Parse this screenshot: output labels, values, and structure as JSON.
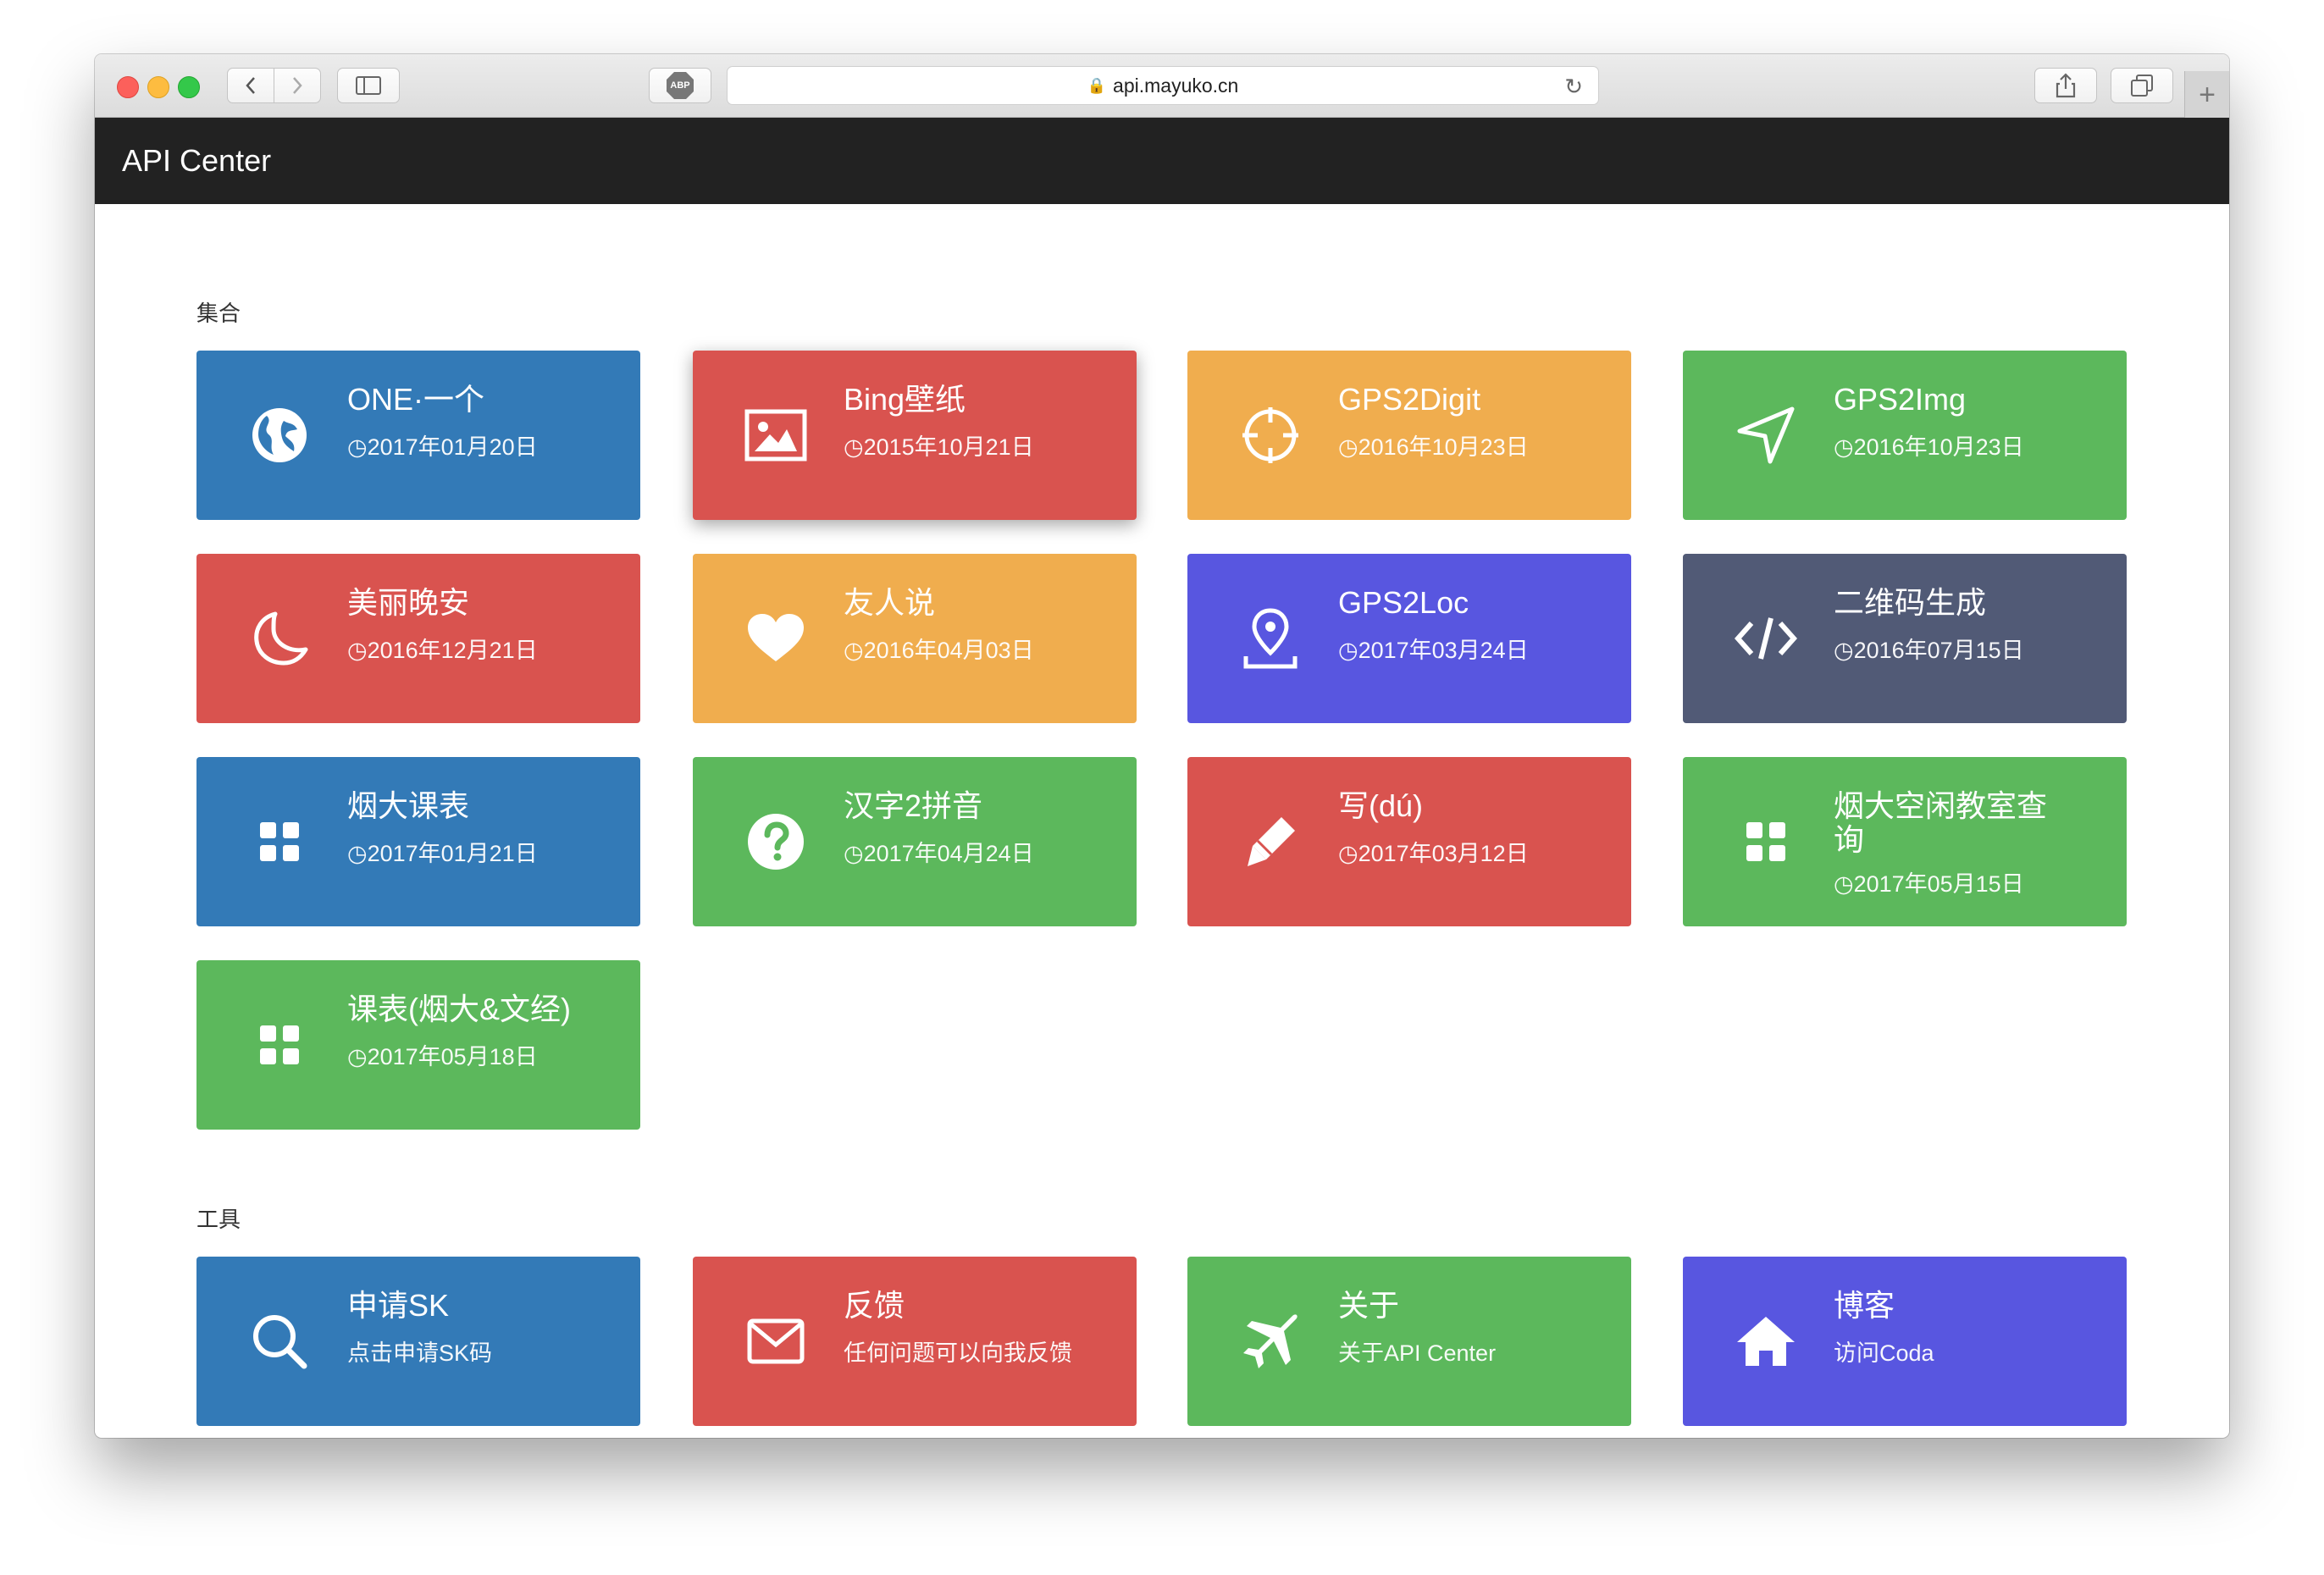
{
  "browser": {
    "url": "api.mayuko.cn",
    "adblock_label": "ABP"
  },
  "navbar": {
    "brand": "API Center"
  },
  "sections": [
    {
      "title": "集合"
    },
    {
      "title": "工具"
    }
  ],
  "collection_tiles": [
    {
      "title": "ONE·一个",
      "date": "2017年01月20日",
      "color": "blue",
      "icon": "globe-icon"
    },
    {
      "title": "Bing壁纸",
      "date": "2015年10月21日",
      "color": "red",
      "icon": "picture-icon"
    },
    {
      "title": "GPS2Digit",
      "date": "2016年10月23日",
      "color": "orange",
      "icon": "crosshair-icon"
    },
    {
      "title": "GPS2Img",
      "date": "2016年10月23日",
      "color": "green",
      "icon": "send-arrow-icon"
    },
    {
      "title": "美丽晚安",
      "date": "2016年12月21日",
      "color": "red",
      "icon": "moon-icon"
    },
    {
      "title": "友人说",
      "date": "2016年04月03日",
      "color": "orange",
      "icon": "heart-icon"
    },
    {
      "title": "GPS2Loc",
      "date": "2017年03月24日",
      "color": "purple",
      "icon": "map-pin-icon"
    },
    {
      "title": "二维码生成",
      "date": "2016年07月15日",
      "color": "slate",
      "icon": "code-icon"
    },
    {
      "title": "烟大课表",
      "date": "2017年01月21日",
      "color": "blue",
      "icon": "grid-icon"
    },
    {
      "title": "汉字2拼音",
      "date": "2017年04月24日",
      "color": "green",
      "icon": "question-icon"
    },
    {
      "title": "写(dú)",
      "date": "2017年03月12日",
      "color": "red",
      "icon": "pencil-icon"
    },
    {
      "title": "烟大空闲教室查询",
      "date": "2017年05月15日",
      "color": "green",
      "icon": "grid-icon"
    },
    {
      "title": "课表(烟大&文经)",
      "date": "2017年05月18日",
      "color": "green",
      "icon": "grid-icon"
    }
  ],
  "tool_tiles": [
    {
      "title": "申请SK",
      "subtitle": "点击申请SK码",
      "color": "blue",
      "icon": "search-icon"
    },
    {
      "title": "反馈",
      "subtitle": "任何问题可以向我反馈",
      "color": "red",
      "icon": "envelope-icon"
    },
    {
      "title": "关于",
      "subtitle": "关于API Center",
      "color": "green",
      "icon": "plane-icon"
    },
    {
      "title": "博客",
      "subtitle": "访问Coda",
      "color": "purple",
      "icon": "home-icon"
    }
  ],
  "colors": {
    "blue": "#337ab7",
    "red": "#d9534f",
    "orange": "#f0ad4e",
    "green": "#5cb85c",
    "purple": "#5856e0",
    "slate": "#515a76",
    "navbar": "#222222"
  }
}
